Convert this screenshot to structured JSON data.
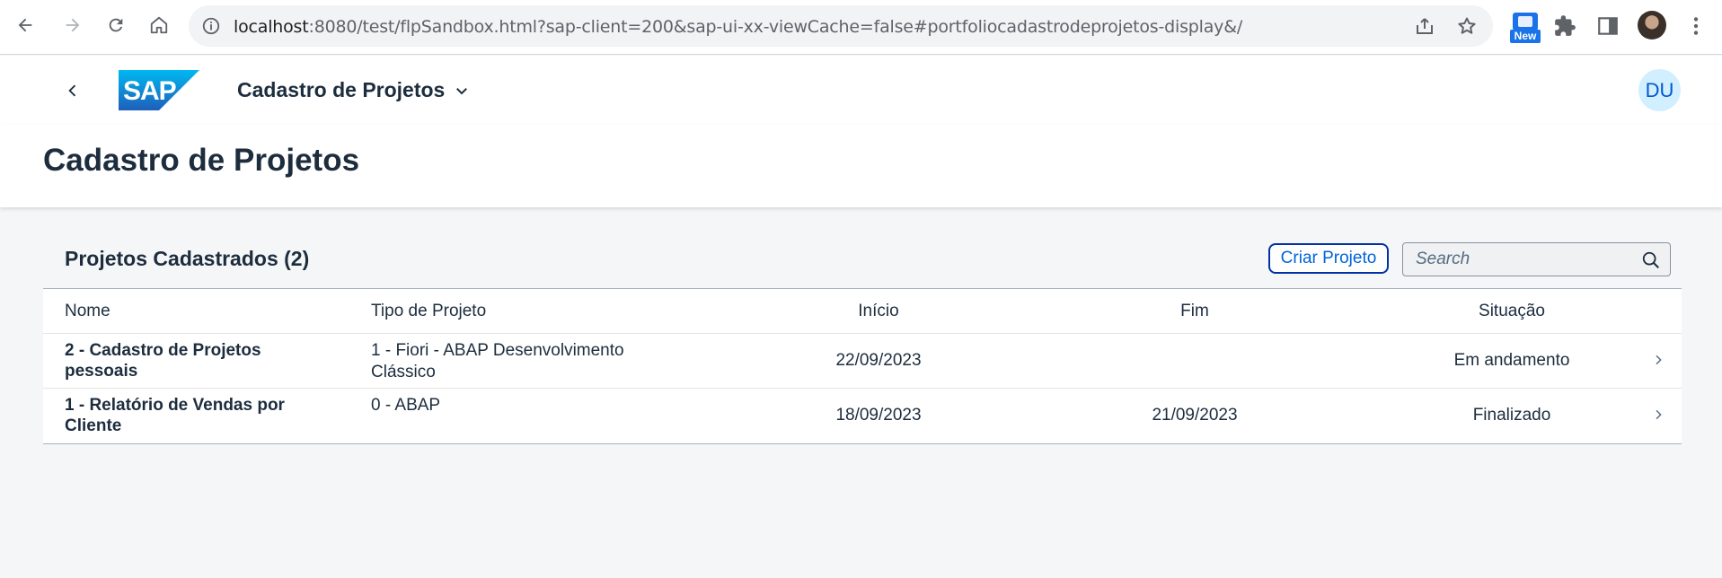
{
  "browser": {
    "url_host": "localhost",
    "url_rest": ":8080/test/flpSandbox.html?sap-client=200&sap-ui-xx-viewCache=false#portfoliocadastrodeprojetos-display&/",
    "extension_badge": "New",
    "icons": [
      "back-arrow-icon",
      "forward-arrow-icon",
      "reload-icon",
      "home-icon",
      "site-info-icon",
      "share-icon",
      "bookmark-star-icon",
      "extensions-puzzle-icon",
      "side-panel-icon",
      "menu-kebab-icon"
    ]
  },
  "shell": {
    "logo_text": "SAP",
    "app_title": "Cadastro de Projetos",
    "avatar_initials": "DU"
  },
  "page": {
    "title": "Cadastro de Projetos"
  },
  "table": {
    "title": "Projetos Cadastrados (2)",
    "create_button": "Criar Projeto",
    "search_placeholder": "Search",
    "columns": {
      "nome": "Nome",
      "tipo": "Tipo de Projeto",
      "inicio": "Início",
      "fim": "Fim",
      "situacao": "Situação"
    },
    "rows": [
      {
        "nome": "2 - Cadastro de Projetos pessoais",
        "tipo": "1 - Fiori - ABAP Desenvolvimento Clássico",
        "inicio": "22/09/2023",
        "fim": "",
        "situacao": "Em andamento"
      },
      {
        "nome": "1 - Relatório de Vendas por Cliente",
        "tipo": "0 - ABAP",
        "inicio": "18/09/2023",
        "fim": "21/09/2023",
        "situacao": "Finalizado"
      }
    ]
  },
  "colors": {
    "sap_blue": "#0a6ed1",
    "shell_text": "#1d2d3e",
    "page_background": "#f5f6f7",
    "button_border": "#0032a5",
    "button_text": "#0064d9",
    "avatar_bg": "#d1efff"
  }
}
